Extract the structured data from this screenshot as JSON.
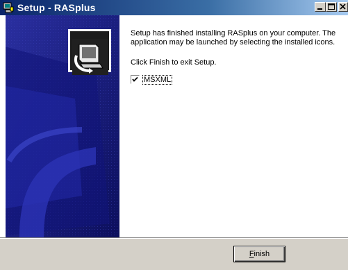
{
  "window": {
    "title": "Setup - RASplus",
    "icon": "setup-computer-icon"
  },
  "titlebar_buttons": {
    "minimize_icon": "minimize-icon",
    "maximize_icon": "maximize-icon",
    "close_icon": "close-icon"
  },
  "content": {
    "finished_message": "Setup has finished installing RASplus on your computer. The application may be launched by selecting the installed icons.",
    "exit_instruction": "Click Finish to exit Setup.",
    "checkbox": {
      "label": "MSXML",
      "checked": true
    }
  },
  "buttons": {
    "finish_prefix": "",
    "finish_mnemonic": "F",
    "finish_rest": "inish"
  },
  "colors": {
    "side_panel": "#1a1f8a",
    "title_bar_start": "#0a246a",
    "title_bar_end": "#a6caf0",
    "dialog_face": "#d4d0c8"
  }
}
